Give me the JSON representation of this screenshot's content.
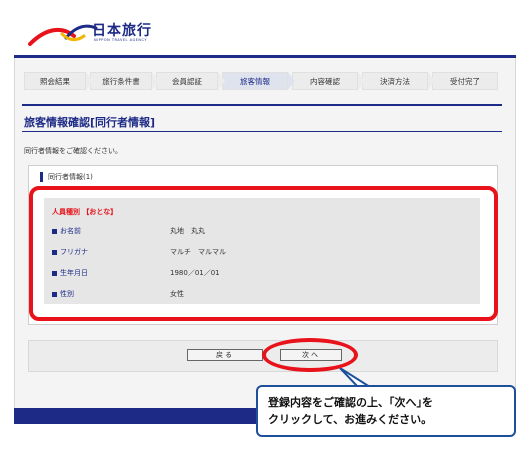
{
  "header": {
    "logo_text": "日本旅行",
    "logo_sub": "NIPPON TRAVEL AGENCY",
    "brand_color": "#1d2a86",
    "accent_red": "#e8121b"
  },
  "steps": [
    {
      "label": "照会結果",
      "active": false
    },
    {
      "label": "旅行条件書",
      "active": false
    },
    {
      "label": "会員認証",
      "active": false
    },
    {
      "label": "旅客情報",
      "active": true
    },
    {
      "label": "内容確認",
      "active": false
    },
    {
      "label": "決済方法",
      "active": false
    },
    {
      "label": "受付完了",
      "active": false
    }
  ],
  "page_title": "旅客情報確認[同行者情報]",
  "intro": "同行者情報をご確認ください。",
  "companion": {
    "heading": "同行者情報(1)",
    "passenger_type": "人員種別 【おとな】",
    "fields": [
      {
        "label": "お名前",
        "value": "丸地　丸丸"
      },
      {
        "label": "フリガナ",
        "value": "マルチ　マルマル"
      },
      {
        "label": "生年月日",
        "value": "1980／01／01"
      },
      {
        "label": "性別",
        "value": "女性"
      }
    ]
  },
  "actions": {
    "back_label": "戻る",
    "next_label": "次へ"
  },
  "callout": {
    "line1": "登録内容をご確認の上、｢次へ｣を",
    "line2": "クリックして、お進みください。"
  }
}
